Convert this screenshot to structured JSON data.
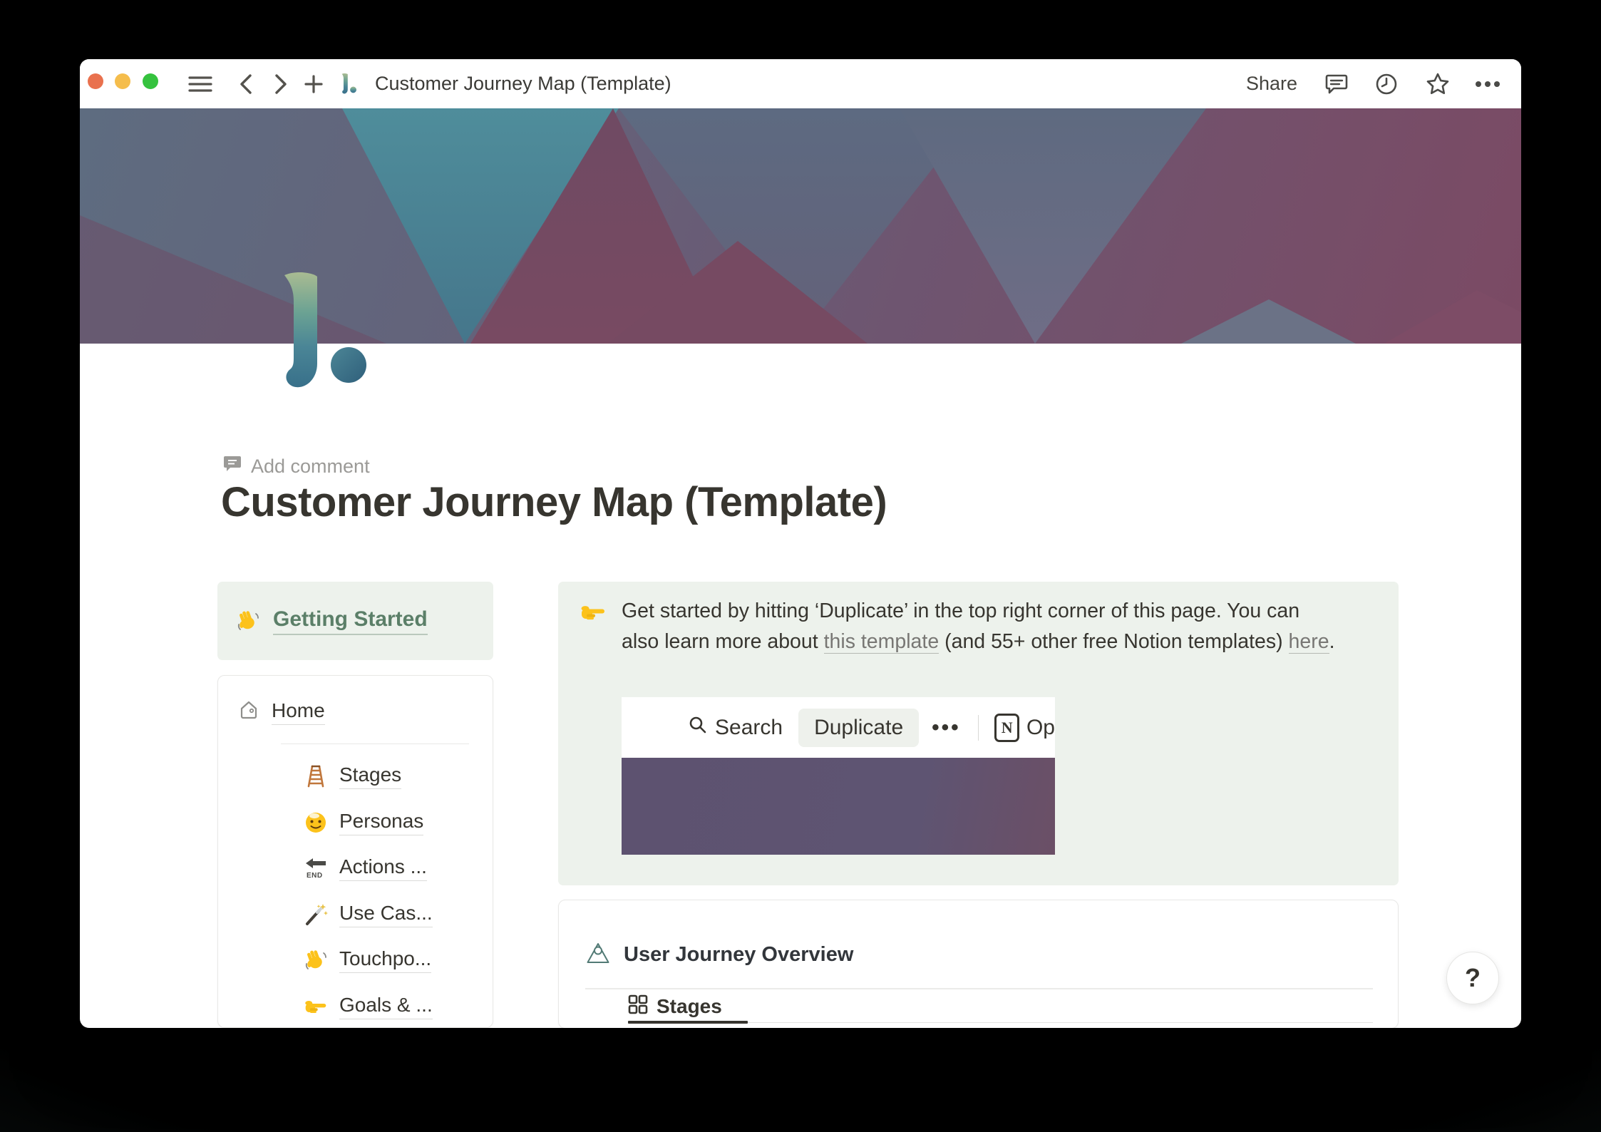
{
  "titlebar": {
    "title": "Customer Journey Map (Template)",
    "share_label": "Share"
  },
  "page": {
    "add_comment_label": "Add comment",
    "title": "Customer Journey Map (Template)"
  },
  "getting_started": {
    "label": "Getting Started",
    "icon": "wave-emoji"
  },
  "sidebar": {
    "home_label": "Home",
    "items": [
      {
        "icon": "ladder-emoji",
        "label": "Stages"
      },
      {
        "icon": "smiley-emoji",
        "label": "Personas"
      },
      {
        "icon": "end-arrow-emoji",
        "label": "Actions ..."
      },
      {
        "icon": "wand-emoji",
        "label": "Use Cas..."
      },
      {
        "icon": "wave-emoji",
        "label": "Touchpo..."
      },
      {
        "icon": "point-right-emoji",
        "label": "Goals & ..."
      }
    ]
  },
  "callout": {
    "icon": "point-right-emoji",
    "segments": [
      {
        "t": "Get started by hitting ‘Duplicate’ in the top right corner of this page. You can"
      },
      {
        "br": true
      },
      {
        "t": "also learn more about "
      },
      {
        "t": "this template",
        "link": true
      },
      {
        "t": " (and 55+ other free Notion templates) "
      },
      {
        "t": "here",
        "link": true
      },
      {
        "t": "."
      }
    ]
  },
  "embed_screenshot": {
    "search_label": "Search",
    "duplicate_label": "Duplicate",
    "more_dots": "•••",
    "notion_letter": "N",
    "open_partial_label": "Op"
  },
  "overview": {
    "title": "User Journey Overview",
    "tab_label": "Stages"
  },
  "help": {
    "label": "?"
  },
  "colors": {
    "callout_bg": "#edf2ec",
    "link_green": "#5b7f68",
    "text": "#37352f",
    "muted_link": "#787774",
    "banner_teal": "#4f8d9b",
    "banner_slate": "#5e6c80",
    "banner_maroon": "#7b4a64",
    "embed_purple": "#5d5270",
    "traffic_red": "#e9714e",
    "traffic_yellow": "#f5bd4c",
    "traffic_green": "#35c23e"
  }
}
